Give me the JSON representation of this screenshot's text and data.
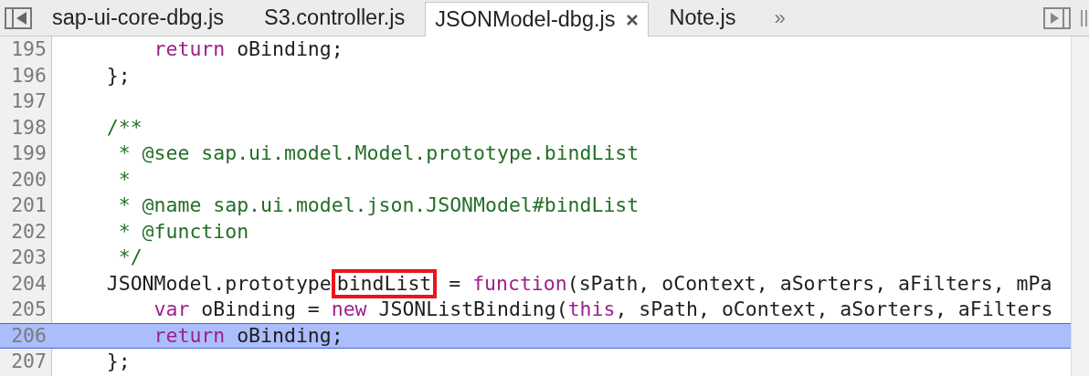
{
  "tabs": [
    {
      "label": "sap-ui-core-dbg.js",
      "selected": false,
      "closable": false
    },
    {
      "label": "S3.controller.js",
      "selected": false,
      "closable": false
    },
    {
      "label": "JSONModel-dbg.js",
      "selected": true,
      "closable": true
    },
    {
      "label": "Note.js",
      "selected": false,
      "closable": false
    }
  ],
  "more_tabs": "»",
  "lines": [
    {
      "number": "195",
      "selected": false,
      "tokens": [
        {
          "kind": "keyword",
          "text": "        return"
        },
        {
          "kind": "plain",
          "text": " oBinding;"
        }
      ]
    },
    {
      "number": "196",
      "selected": false,
      "tokens": [
        {
          "kind": "plain",
          "text": "    };"
        }
      ]
    },
    {
      "number": "197",
      "selected": false
    },
    {
      "number": "198",
      "selected": false,
      "tokens": [
        {
          "kind": "comment",
          "text": "    /**"
        }
      ]
    },
    {
      "number": "199",
      "selected": false,
      "tokens": [
        {
          "kind": "comment",
          "text": "     * @see sap.ui.model.Model.prototype.bindList"
        }
      ]
    },
    {
      "number": "200",
      "selected": false,
      "tokens": [
        {
          "kind": "comment",
          "text": "     *"
        }
      ]
    },
    {
      "number": "201",
      "selected": false,
      "tokens": [
        {
          "kind": "comment",
          "text": "     * @name sap.ui.model.json.JSONModel#bindList"
        }
      ]
    },
    {
      "number": "202",
      "selected": false,
      "tokens": [
        {
          "kind": "comment",
          "text": "     * @function"
        }
      ]
    },
    {
      "number": "203",
      "selected": false,
      "tokens": [
        {
          "kind": "comment",
          "text": "     */"
        }
      ]
    },
    {
      "number": "204",
      "selected": false,
      "tokens": [
        {
          "kind": "plain",
          "text": "    JSONModel.prototype"
        },
        {
          "kind": "highlight",
          "text": "bindList"
        },
        {
          "kind": "plain",
          "text": " = "
        },
        {
          "kind": "keyword",
          "text": "function"
        },
        {
          "kind": "plain",
          "text": "(sPath, oContext, aSorters, aFilters, mPa"
        }
      ]
    },
    {
      "number": "205",
      "selected": false,
      "tokens": [
        {
          "kind": "keyword",
          "text": "        var"
        },
        {
          "kind": "plain",
          "text": " oBinding = "
        },
        {
          "kind": "keyword",
          "text": "new"
        },
        {
          "kind": "plain",
          "text": " JSONListBinding("
        },
        {
          "kind": "keyword",
          "text": "this"
        },
        {
          "kind": "plain",
          "text": ", sPath, oContext, aSorters, aFilters"
        }
      ]
    },
    {
      "number": "206",
      "selected": true,
      "tokens": [
        {
          "kind": "keyword",
          "text": "        return"
        },
        {
          "kind": "plain",
          "text": " oBinding;"
        }
      ]
    },
    {
      "number": "207",
      "selected": false,
      "tokens": [
        {
          "kind": "plain",
          "text": "    };"
        }
      ]
    }
  ]
}
